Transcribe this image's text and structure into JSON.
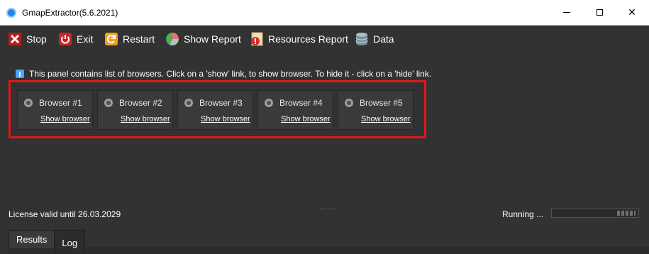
{
  "window": {
    "title": "GmapExtractor(5.6.2021)",
    "app_icon": "app-logo-icon",
    "controls": {
      "minimize": "minimize-icon",
      "maximize": "maximize-icon",
      "close_glyph": "✕"
    }
  },
  "toolbar": {
    "items": [
      {
        "label": "Stop",
        "icon": "stop-icon",
        "color": "#c62828"
      },
      {
        "label": "Exit",
        "icon": "power-icon",
        "color": "#c62828"
      },
      {
        "label": "Restart",
        "icon": "restart-icon",
        "color": "#f0a020"
      },
      {
        "label": "Show Report",
        "icon": "pie-chart-icon",
        "color": "#4caf50"
      },
      {
        "label": "Resources Report",
        "icon": "warning-report-icon",
        "color": "#d32f2f"
      },
      {
        "label": "Data",
        "icon": "database-icon",
        "color": "#90a4ae"
      }
    ]
  },
  "info": {
    "text": "This panel contains list of browsers. Click on a 'show' link, to show browser. To hide it - click on a 'hide' link."
  },
  "browsers": [
    {
      "name": "Browser #1",
      "link": "Show browser"
    },
    {
      "name": "Browser #2",
      "link": "Show browser"
    },
    {
      "name": "Browser #3",
      "link": "Show browser"
    },
    {
      "name": "Browser #4",
      "link": "Show browser"
    },
    {
      "name": "Browser #5",
      "link": "Show browser"
    }
  ],
  "splitter": "......",
  "status": {
    "license": "License valid until 26.03.2029",
    "running": "Running ..."
  },
  "tabs": [
    {
      "label": "Results",
      "active": false
    },
    {
      "label": "Log",
      "active": true
    }
  ],
  "colors": {
    "background": "#323232",
    "highlight": "#e0161b",
    "text": "#ffffff"
  }
}
